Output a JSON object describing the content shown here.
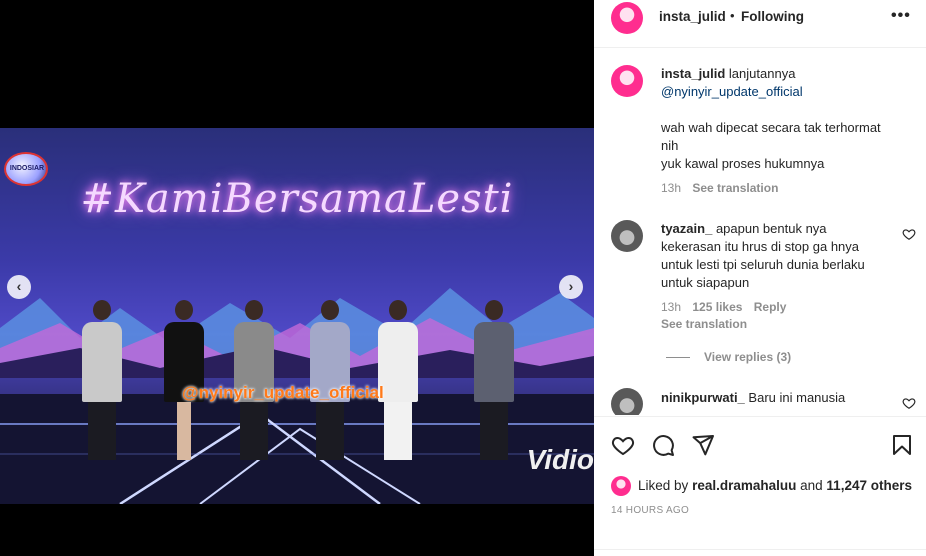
{
  "post": {
    "username": "insta_julid",
    "separator": "•",
    "follow_status": "Following",
    "more_icon": "more-horizontal-icon"
  },
  "media": {
    "stage_title": "#KamiBersamaLesti",
    "channel_logo_text": "INDOSIAR",
    "watermark": "@nyinyir_update_official",
    "brand": "Vidio",
    "prev_icon": "chevron-left-icon",
    "next_icon": "chevron-right-icon",
    "sound_icon": "speaker-mute-icon"
  },
  "caption": {
    "username": "insta_julid",
    "line1": "lanjutannya",
    "mention": "@nyinyir_update_official",
    "line2": "wah wah dipecat secara tak terhormat",
    "line3": "nih",
    "line4": "yuk kawal proses hukumnya",
    "time": "13h",
    "see_translation": "See translation"
  },
  "comments": [
    {
      "username": "tyazain_",
      "line1": "apapun bentuk nya",
      "line2": "kekerasan itu hrus di stop ga hnya",
      "line3": "untuk lesti tpi seluruh dunia berlaku",
      "line4": "untuk siapapun",
      "time": "13h",
      "likes": "125 likes",
      "reply": "Reply",
      "see_translation": "See translation",
      "view_replies": "View replies (3)"
    },
    {
      "username": "ninikpurwati_",
      "line1": "Baru ini manusia"
    }
  ],
  "actions": {
    "like_icon": "heart-icon",
    "comment_icon": "comment-icon",
    "share_icon": "share-icon",
    "save_icon": "bookmark-icon"
  },
  "likes": {
    "prefix": "Liked by",
    "user": "real.dramahaluu",
    "and": "and",
    "others": "11,247 others"
  },
  "time_ago": "14 HOURS AGO",
  "colors": {
    "link": "#00376b",
    "muted": "#8e8e8e",
    "text": "#262626",
    "avatar_ring": "#ff2d8f"
  }
}
